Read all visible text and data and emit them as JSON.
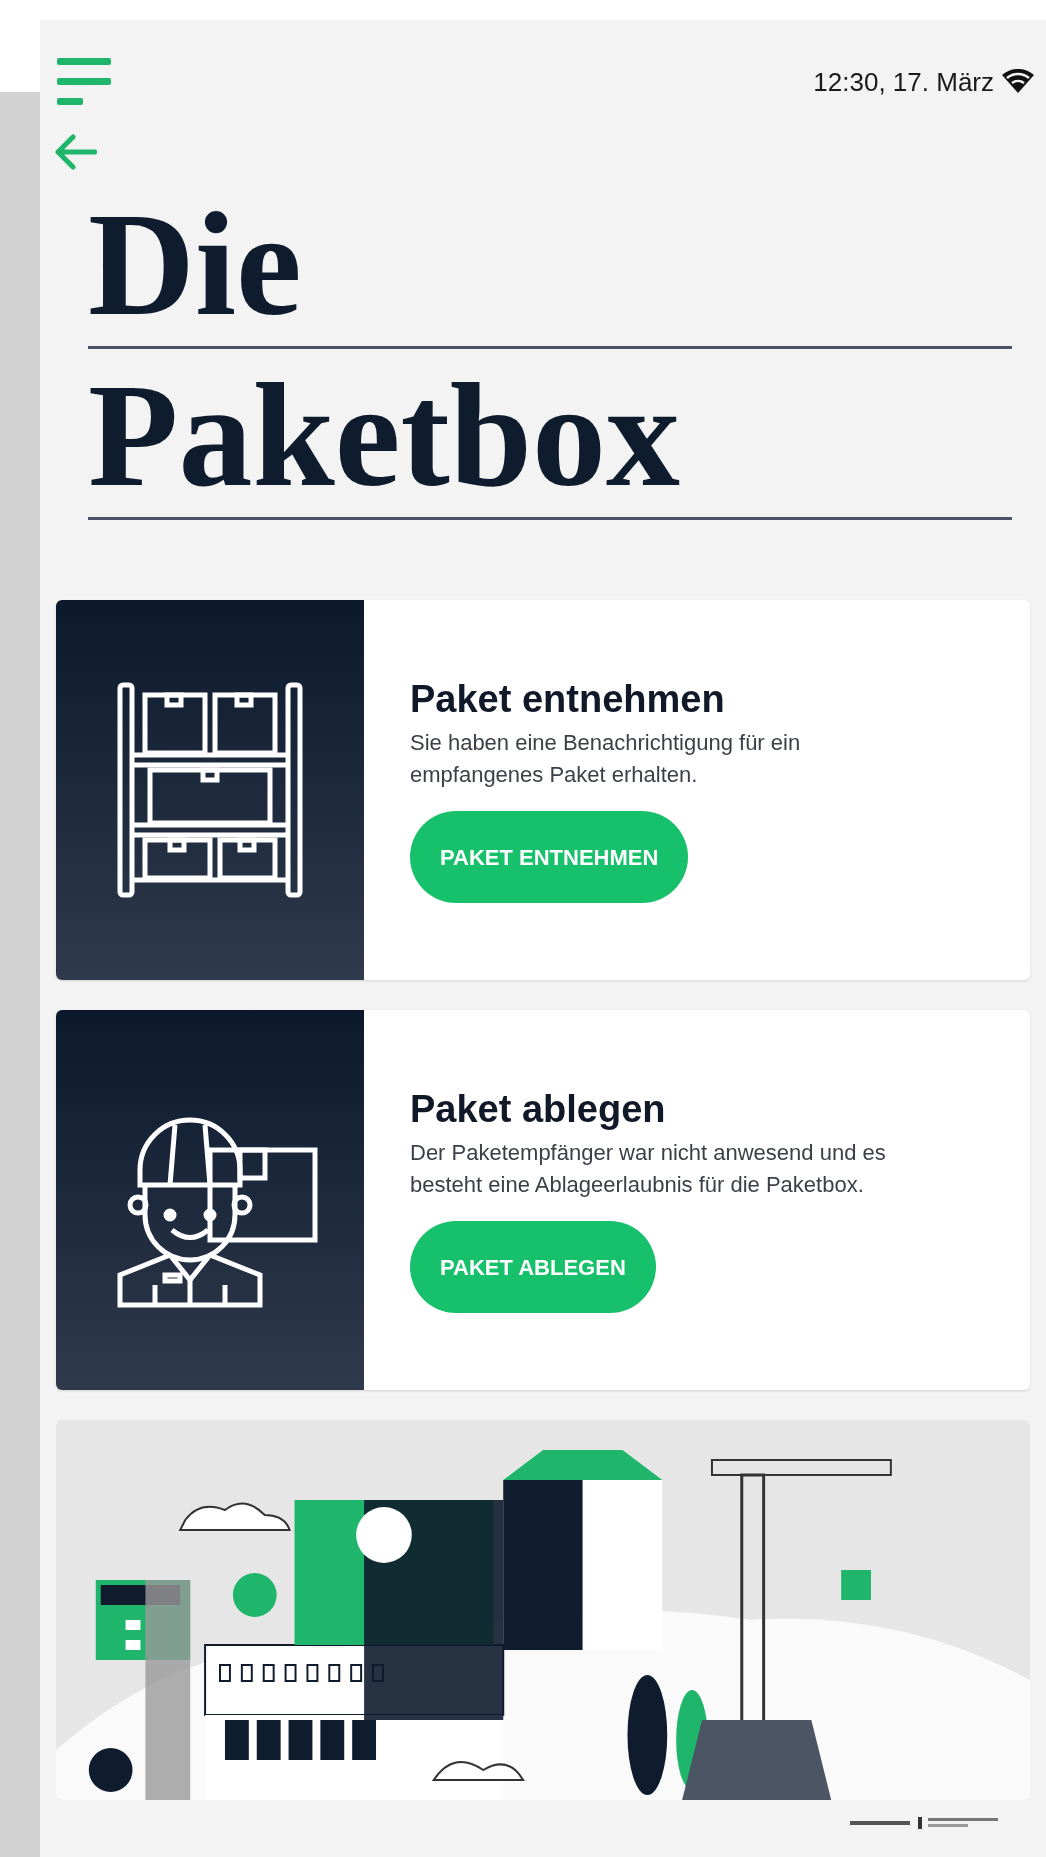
{
  "status_bar": {
    "time": "12:30, 17. März"
  },
  "title_lines": [
    "Die",
    "Paketbox"
  ],
  "cards": [
    {
      "kind": "shelf",
      "title": "Paket entnehmen",
      "description": "Sie haben eine Benachrichtigung für ein empfangenes Paket erhalten.",
      "button": "PAKET ENTNEHMEN"
    },
    {
      "kind": "courier",
      "title": "Paket ablegen",
      "description": "Der Paketempfänger war nicht anwesend und es besteht eine Ablageerlaubnis für die Paketbox.",
      "button": "PAKET ABLEGEN"
    }
  ]
}
